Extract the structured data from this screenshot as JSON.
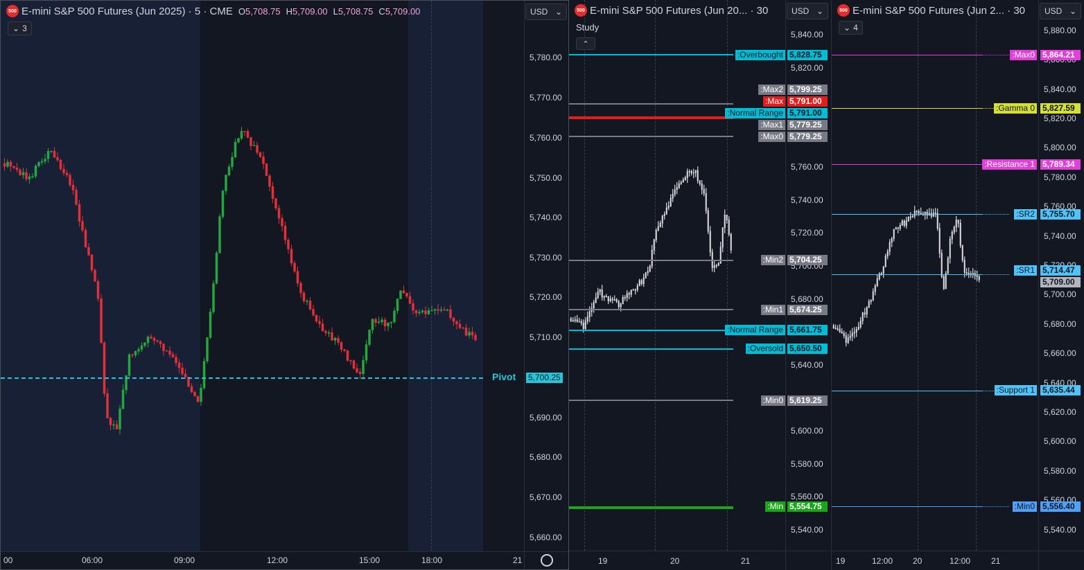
{
  "panes": [
    {
      "title": "E-mini S&P 500 Futures (Jun 2025) · 5 · CME",
      "logo": "500",
      "ohlc": [
        {
          "k": "O",
          "v": "5,708.75"
        },
        {
          "k": "H",
          "v": "5,709.00"
        },
        {
          "k": "L",
          "v": "5,708.75"
        },
        {
          "k": "C",
          "v": "5,709.00"
        }
      ],
      "indicators_count": "3",
      "currency": "USD",
      "y_ticks": [
        "5,780.00",
        "5,770.00",
        "5,760.00",
        "5,750.00",
        "5,740.00",
        "5,730.00",
        "5,720.00",
        "5,710.00",
        "5,690.00",
        "5,680.00",
        "5,670.00",
        "5,660.00"
      ],
      "x_ticks": [
        "00",
        "06:00",
        "09:00",
        "12:00",
        "15:00",
        "18:00",
        "21"
      ],
      "pivot_label": "Pivot",
      "pivot_value": "5,700.25"
    },
    {
      "title": "E-mini S&P 500 Futures (Jun 20... · 30",
      "logo": "500",
      "currency": "USD",
      "study_label": "Study",
      "y_ticks": [
        "5,840.00",
        "5,820.00",
        "5,760.00",
        "5,740.00",
        "5,720.00",
        "5,700.00",
        "5,680.00",
        "5,640.00",
        "5,600.00",
        "5,580.00",
        "5,560.00",
        "5,540.00"
      ],
      "x_ticks": [
        "19",
        "20",
        "21"
      ],
      "levels": [
        {
          "label": ":Overbought",
          "value": "5,828.75",
          "color": "#00bcd4"
        },
        {
          "label": ":Max2",
          "value": "5,799.25",
          "color": "#787b86"
        },
        {
          "label": ":Max",
          "value": "5,791.00",
          "color": "#e31c1c"
        },
        {
          "label": ":Normal Range",
          "value": "5,791.00",
          "color": "#00bcd4"
        },
        {
          "label": ":Max1",
          "value": "5,779.25",
          "color": "#787b86"
        },
        {
          "label": ":Max0",
          "value": "5,779.25",
          "color": "#787b86"
        },
        {
          "label": ":Min2",
          "value": "5,704.25",
          "color": "#787b86"
        },
        {
          "label": ":Min1",
          "value": "5,674.25",
          "color": "#787b86"
        },
        {
          "label": ":Normal Range",
          "value": "5,661.75",
          "color": "#00bcd4"
        },
        {
          "label": ":Oversold",
          "value": "5,650.50",
          "color": "#00bcd4"
        },
        {
          "label": ":Min0",
          "value": "5,619.25",
          "color": "#787b86"
        },
        {
          "label": ":Min",
          "value": "5,554.75",
          "color": "#1aa51a"
        }
      ]
    },
    {
      "title": "E-mini S&P 500 Futures (Jun 2... · 30",
      "logo": "500",
      "indicators_count": "4",
      "currency": "USD",
      "y_ticks": [
        "5,880.00",
        "5,860.00",
        "5,840.00",
        "5,820.00",
        "5,800.00",
        "5,780.00",
        "5,760.00",
        "5,740.00",
        "5,720.00",
        "5,700.00",
        "5,680.00",
        "5,660.00",
        "5,640.00",
        "5,620.00",
        "5,600.00",
        "5,580.00",
        "5,560.00",
        "5,540.00"
      ],
      "x_ticks": [
        "19",
        "12:00",
        "20",
        "12:00",
        "21"
      ],
      "levels": [
        {
          "label": ":Max0",
          "value": "5,864.21",
          "color": "#e040d8"
        },
        {
          "label": ":Gamma 0",
          "value": "5,827.59",
          "color": "#d4e033"
        },
        {
          "label": ":Resistance 1",
          "value": "5,789.34",
          "color": "#e040d8"
        },
        {
          "label": ":SR2",
          "value": "5,755.70",
          "color": "#4fc3f7"
        },
        {
          "label": ":SR1",
          "value": "5,714.47",
          "color": "#4fc3f7"
        },
        {
          "label": "",
          "value": "5,709.00",
          "color": "#b2b5be"
        },
        {
          "label": ":Support 1",
          "value": "5,635.44",
          "color": "#4fc3f7"
        },
        {
          "label": ":Min0",
          "value": "5,556.40",
          "color": "#4fa0f7"
        }
      ]
    }
  ],
  "icons": {
    "chevron": "chevron-down-icon",
    "chevron_up": "chevron-up-icon",
    "settings": "gear-icon",
    "logo": "cme-logo-icon"
  }
}
